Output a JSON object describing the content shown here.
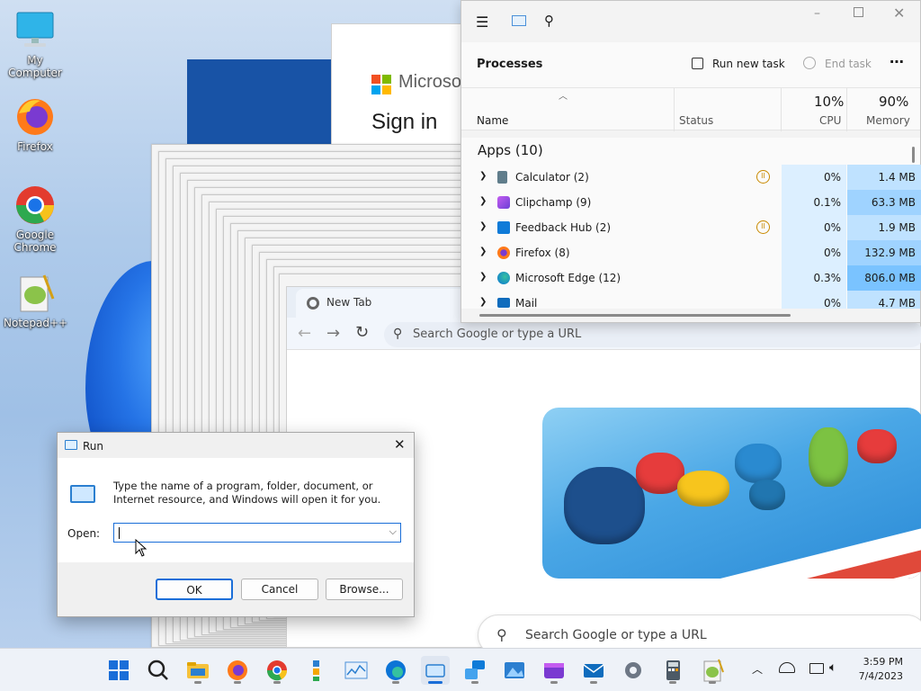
{
  "desktop": {
    "icons": [
      {
        "label": "My Computer",
        "icon": "monitor-icon"
      },
      {
        "label": "Firefox",
        "icon": "firefox-icon"
      },
      {
        "label": "Google Chrome",
        "icon": "chrome-icon"
      },
      {
        "label": "Notepad++",
        "icon": "notepadpp-icon"
      }
    ]
  },
  "signin": {
    "brand": "Microsoft",
    "heading": "Sign in"
  },
  "chrome": {
    "tab_title": "New Tab",
    "omnibox_placeholder": "Search Google or type a URL",
    "search_placeholder": "Search Google or type a URL"
  },
  "task_manager": {
    "section_title": "Processes",
    "run_new_task": "Run new task",
    "end_task": "End task",
    "columns": {
      "name": "Name",
      "status": "Status",
      "cpu_pct": "10%",
      "cpu": "CPU",
      "mem_pct": "90%",
      "memory": "Memory"
    },
    "group": "Apps (10)",
    "rows": [
      {
        "name": "Calculator (2)",
        "cpu": "0%",
        "memory": "1.4 MB",
        "suspended": true
      },
      {
        "name": "Clipchamp (9)",
        "cpu": "0.1%",
        "memory": "63.3 MB",
        "suspended": false
      },
      {
        "name": "Feedback Hub (2)",
        "cpu": "0%",
        "memory": "1.9 MB",
        "suspended": true
      },
      {
        "name": "Firefox (8)",
        "cpu": "0%",
        "memory": "132.9 MB",
        "suspended": false
      },
      {
        "name": "Microsoft Edge (12)",
        "cpu": "0.3%",
        "memory": "806.0 MB",
        "suspended": false
      },
      {
        "name": "Mail",
        "cpu": "0%",
        "memory": "4.7 MB",
        "suspended": false
      }
    ]
  },
  "run_dialog": {
    "title": "Run",
    "description": "Type the name of a program, folder, document, or Internet resource, and Windows will open it for you.",
    "open_label": "Open:",
    "open_value": "",
    "ok": "OK",
    "cancel": "Cancel",
    "browse": "Browse..."
  },
  "taskbar": {
    "apps": [
      "start-icon",
      "search-icon",
      "file-explorer-icon",
      "firefox-icon",
      "chrome-icon",
      "widgets-icon",
      "performance-icon",
      "edge-icon",
      "run-icon",
      "feedback-hub-icon",
      "photos-icon",
      "clipchamp-icon",
      "mail-icon",
      "settings-icon",
      "calculator-icon",
      "notepadpp-icon"
    ],
    "time": "3:59 PM",
    "date": "7/4/2023"
  },
  "colors": {
    "accent": "#1a6ed8",
    "cpu_bg": "#dcefff",
    "mem_bg": "#bfe2ff",
    "suspended": "#c98a00"
  }
}
